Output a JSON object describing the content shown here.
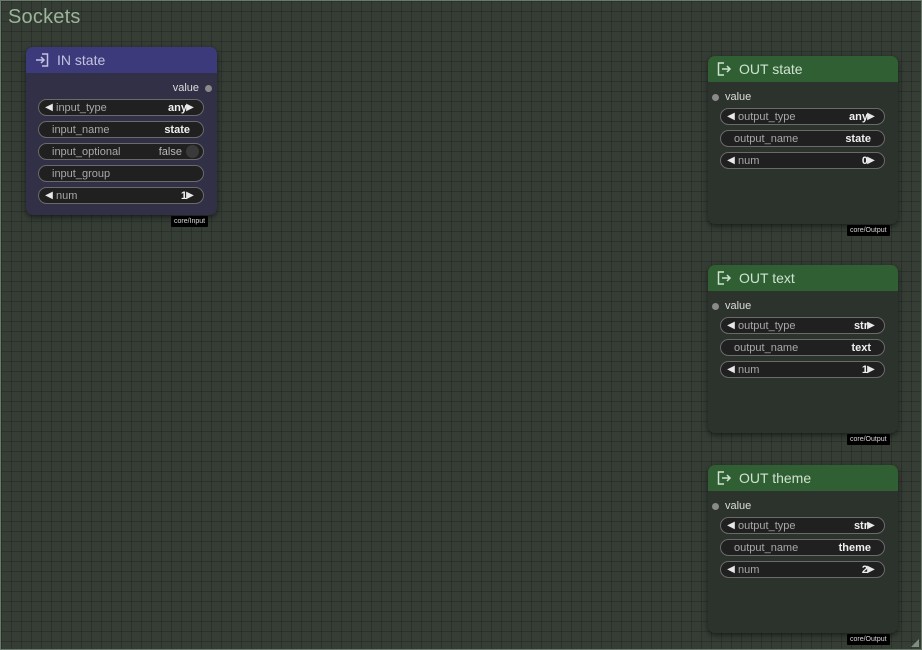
{
  "group": {
    "title": "Sockets"
  },
  "input_node": {
    "title": "IN state",
    "output_slot": "value",
    "widgets": {
      "input_type": {
        "label": "input_type",
        "value": "any"
      },
      "input_name": {
        "label": "input_name",
        "value": "state"
      },
      "input_optional": {
        "label": "input_optional",
        "value": "false"
      },
      "input_group": {
        "label": "input_group",
        "value": ""
      },
      "num": {
        "label": "num",
        "value": "1"
      }
    },
    "tag": "core/Input"
  },
  "output_nodes": [
    {
      "title": "OUT state",
      "input_slot": "value",
      "output_type": {
        "label": "output_type",
        "value": "any"
      },
      "output_name": {
        "label": "output_name",
        "value": "state"
      },
      "num": {
        "label": "num",
        "value": "0"
      },
      "tag": "core/Output"
    },
    {
      "title": "OUT text",
      "input_slot": "value",
      "output_type": {
        "label": "output_type",
        "value": "str"
      },
      "output_name": {
        "label": "output_name",
        "value": "text"
      },
      "num": {
        "label": "num",
        "value": "1"
      },
      "tag": "core/Output"
    },
    {
      "title": "OUT theme",
      "input_slot": "value",
      "output_type": {
        "label": "output_type",
        "value": "str"
      },
      "output_name": {
        "label": "output_name",
        "value": "theme"
      },
      "num": {
        "label": "num",
        "value": "2"
      },
      "tag": "core/Output"
    }
  ],
  "icons": {
    "input": "login-icon",
    "output": "logout-icon"
  },
  "colors": {
    "canvas": "#353d35",
    "input_header": "#3c3a7a",
    "input_body": "#313046",
    "output_header": "#2f5f33",
    "output_body": "#2c332c",
    "group_title": "#9ab59a"
  }
}
